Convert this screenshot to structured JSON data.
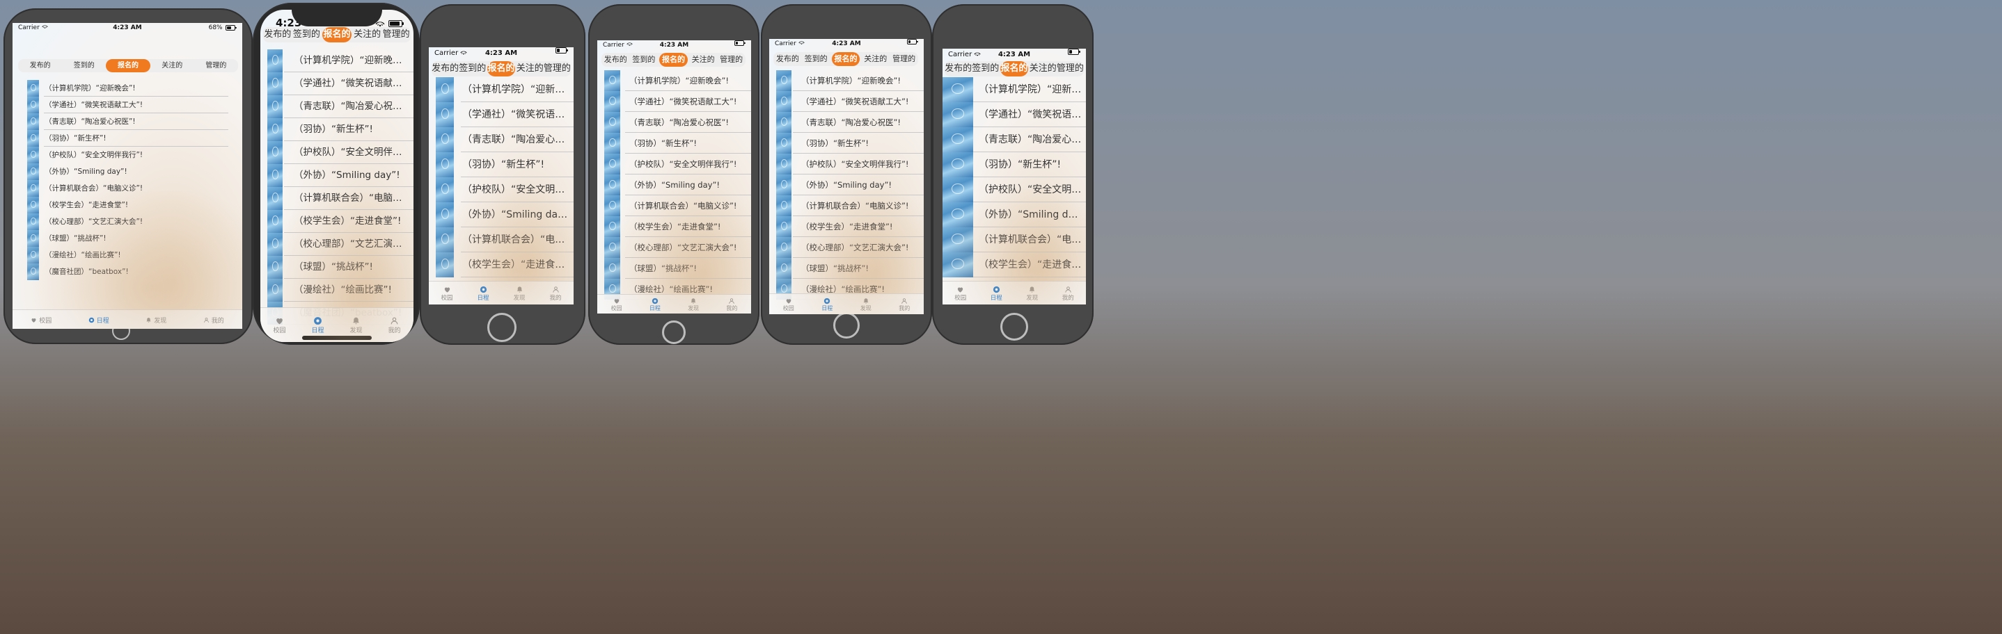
{
  "status": {
    "carrier": "Carrier",
    "time": "4:23 AM",
    "time_short": "4:23",
    "battery_ipad": "68%"
  },
  "segments": [
    "发布的",
    "签到的",
    "报名的",
    "关注的",
    "管理的"
  ],
  "active_segment": "报名的",
  "events": [
    "（计算机学院）“迎新晚会”!",
    "（学通社）“微笑祝语献工大”!",
    "（青志联）“陶冶爱心祝医”!",
    "（羽协）“新生杯”!",
    "（护校队）“安全文明伴我行”!",
    "（外协）“Smiling day”!",
    "（计算机联合会）“电脑义诊”!",
    "（校学生会）“走进食堂”!",
    "（校心理部）“文艺汇演大会”!",
    "（球盟）“挑战杯”!",
    "（漫绘社）“绘画比赛”!",
    "（魔音社团）“beatbox”!"
  ],
  "tabbar": [
    {
      "label": "校园",
      "icon": "heart-icon"
    },
    {
      "label": "日程",
      "icon": "schedule-icon"
    },
    {
      "label": "发现",
      "icon": "bell-icon"
    },
    {
      "label": "我的",
      "icon": "person-icon"
    }
  ],
  "active_tab": "日程",
  "colors": {
    "accent": "#f07a1f",
    "tab_active": "#1677d6",
    "tab_inactive": "#8e8e8e"
  }
}
